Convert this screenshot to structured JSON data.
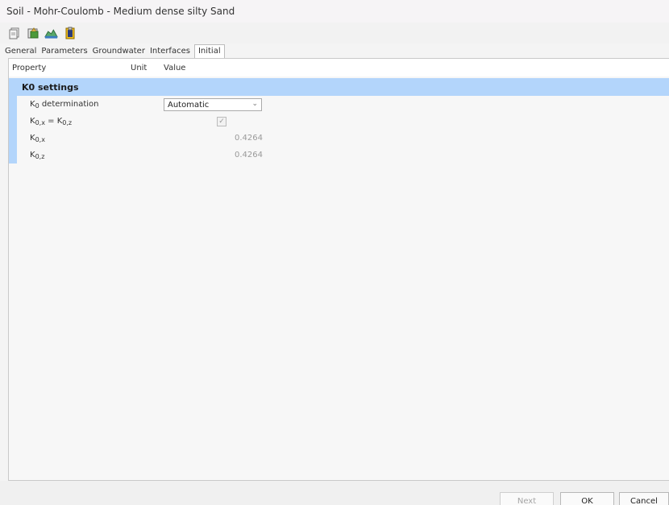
{
  "window": {
    "title": "Soil - Mohr-Coulomb - Medium dense silty Sand"
  },
  "toolbar": {
    "icons": [
      "copy-icon",
      "open-icon",
      "soil-material-icon",
      "clipboard-icon"
    ]
  },
  "tabs": [
    {
      "label": "General"
    },
    {
      "label": "Parameters"
    },
    {
      "label": "Groundwater"
    },
    {
      "label": "Interfaces"
    },
    {
      "label": "Initial",
      "active": true
    }
  ],
  "table": {
    "headers": {
      "property": "Property",
      "unit": "Unit",
      "value": "Value"
    },
    "group": "K0 settings",
    "rows": {
      "k0_determination": {
        "base": "K",
        "sub": "0",
        "suffix": " determination",
        "value": "Automatic"
      },
      "k0x_equals_k0z": {
        "base1": "K",
        "sub1": "0,x",
        "eq": " = ",
        "base2": "K",
        "sub2": "0,z",
        "checked": true
      },
      "k0x": {
        "base": "K",
        "sub": "0,x",
        "value": "0.4264"
      },
      "k0z": {
        "base": "K",
        "sub": "0,z",
        "value": "0.4264"
      }
    }
  },
  "footer": {
    "next_label": "Next",
    "ok_label": "OK",
    "cancel_label": "Cancel"
  }
}
